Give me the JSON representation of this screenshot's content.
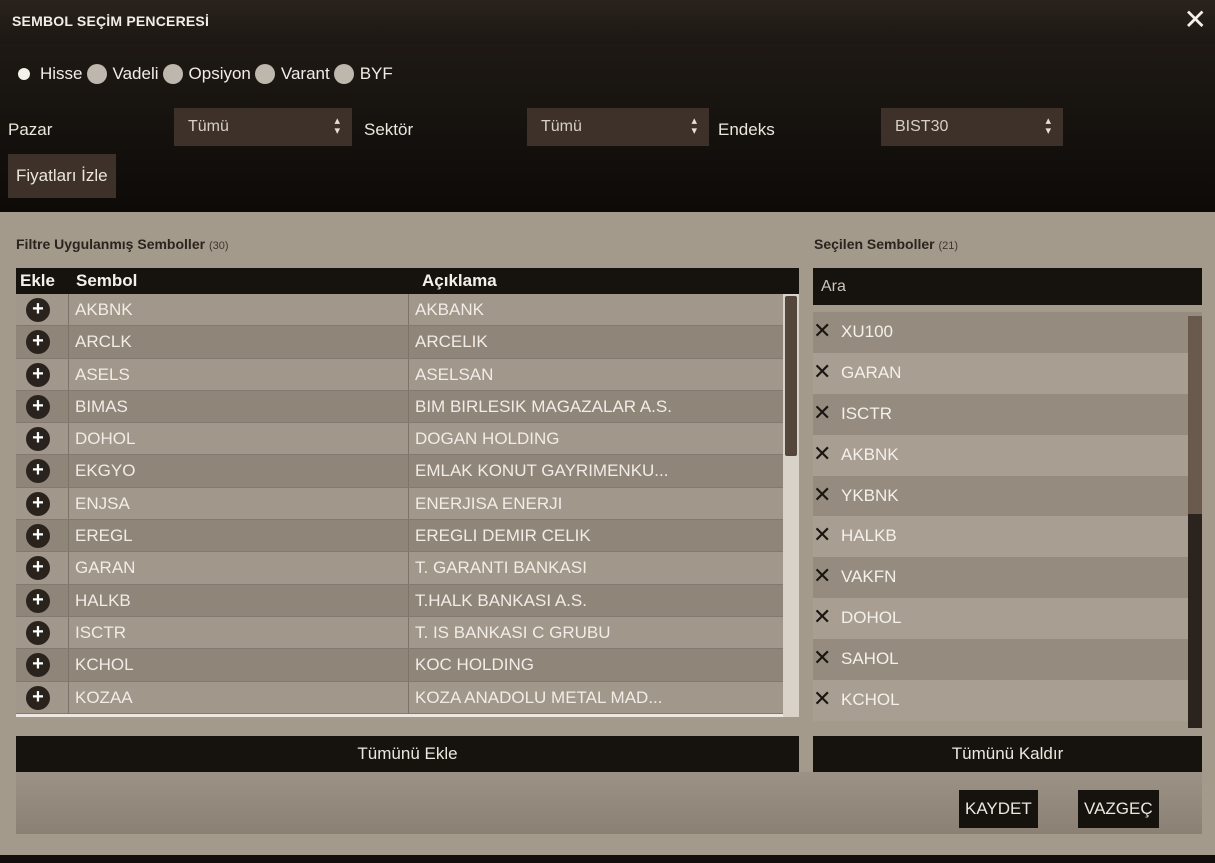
{
  "window": {
    "title": "SEMBOL SEÇİM PENCERESİ",
    "close": "✕"
  },
  "radios": [
    {
      "label": "Hisse",
      "selected": true
    },
    {
      "label": "Vadeli",
      "selected": false
    },
    {
      "label": "Opsiyon",
      "selected": false
    },
    {
      "label": "Varant",
      "selected": false
    },
    {
      "label": "BYF",
      "selected": false
    }
  ],
  "filters": {
    "pazar_label": "Pazar",
    "pazar_value": "Tümü",
    "sektor_label": "Sektör",
    "sektor_value": "Tümü",
    "endeks_label": "Endeks",
    "endeks_value": "BIST30",
    "arrow": "▲▼"
  },
  "prices_button": "Fiyatları İzle",
  "filtered": {
    "title": "Filtre Uygulanmış Semboller",
    "count": "(30)",
    "columns": {
      "add": "Ekle",
      "symbol": "Sembol",
      "description": "Açıklama"
    },
    "add_glyph": "+",
    "rows": [
      {
        "symbol": "AKBNK",
        "description": "AKBANK"
      },
      {
        "symbol": "ARCLK",
        "description": "ARCELIK"
      },
      {
        "symbol": "ASELS",
        "description": "ASELSAN"
      },
      {
        "symbol": "BIMAS",
        "description": "BIM BIRLESIK MAGAZALAR A.S."
      },
      {
        "symbol": "DOHOL",
        "description": "DOGAN HOLDING"
      },
      {
        "symbol": "EKGYO",
        "description": "EMLAK KONUT GAYRIMENKU..."
      },
      {
        "symbol": "ENJSA",
        "description": "ENERJISA ENERJI"
      },
      {
        "symbol": "EREGL",
        "description": "EREGLI DEMIR CELIK"
      },
      {
        "symbol": "GARAN",
        "description": "T. GARANTI BANKASI"
      },
      {
        "symbol": "HALKB",
        "description": "T.HALK BANKASI A.S."
      },
      {
        "symbol": "ISCTR",
        "description": "T. IS BANKASI C GRUBU"
      },
      {
        "symbol": "KCHOL",
        "description": "KOC HOLDING"
      },
      {
        "symbol": "KOZAA",
        "description": "KOZA ANADOLU METAL MAD..."
      }
    ],
    "add_all_button": "Tümünü Ekle"
  },
  "selected": {
    "title": "Seçilen Semboller",
    "count": "(21)",
    "search_placeholder": "Ara",
    "remove_glyph": "✕",
    "items": [
      "XU100",
      "GARAN",
      "ISCTR",
      "AKBNK",
      "YKBNK",
      "HALKB",
      "VAKFN",
      "DOHOL",
      "SAHOL",
      "KCHOL"
    ],
    "remove_all_button": "Tümünü Kaldır"
  },
  "footer": {
    "save": "KAYDET",
    "cancel": "VAZGEÇ"
  }
}
